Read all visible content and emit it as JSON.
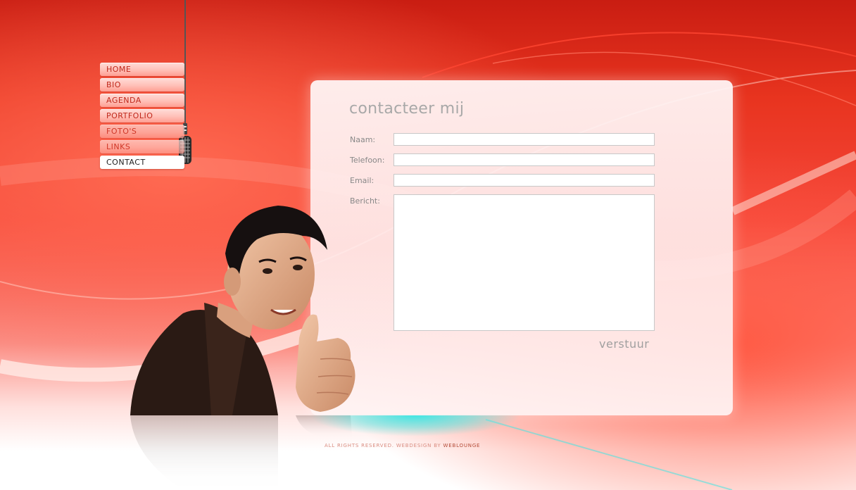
{
  "nav": {
    "items": [
      {
        "label": "HOME"
      },
      {
        "label": "BIO"
      },
      {
        "label": "AGENDA"
      },
      {
        "label": "PORTFOLIO"
      },
      {
        "label": "FOTO'S"
      },
      {
        "label": "LINKS"
      },
      {
        "label": "CONTACT"
      }
    ],
    "active": "CONTACT"
  },
  "contact": {
    "title": "contacteer mij",
    "fields": {
      "name_label": "Naam:",
      "name_value": "",
      "phone_label": "Telefoon:",
      "phone_value": "",
      "email_label": "Email:",
      "email_value": "",
      "message_label": "Bericht:",
      "message_value": ""
    },
    "submit_label": "verstuur"
  },
  "footer": {
    "text": "ALL RIGHTS RESERVED. WEBDESIGN BY",
    "link": "WEBLOUNGE"
  },
  "colors": {
    "background_red": "#e8341f",
    "nav_text": "#c0281b",
    "accent_teal": "#43e6e3"
  },
  "icons": [
    "microphone-icon"
  ]
}
